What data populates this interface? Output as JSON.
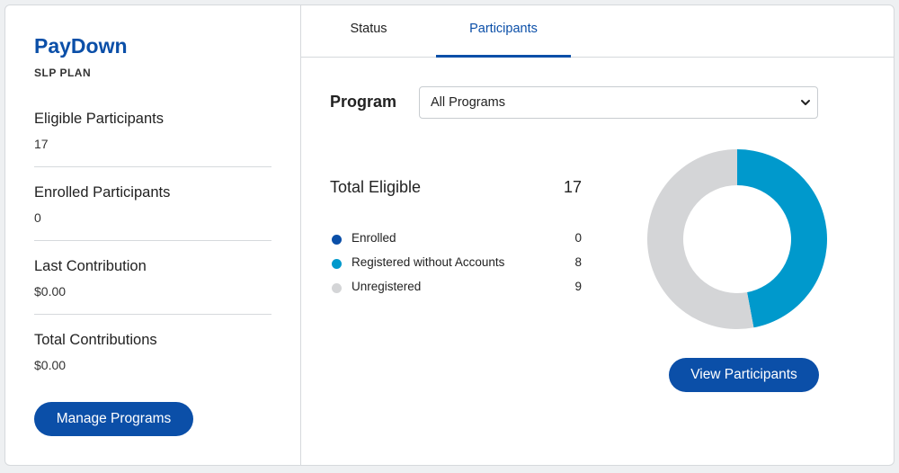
{
  "sidebar": {
    "title": "PayDown",
    "subtitle": "SLP PLAN",
    "stats": [
      {
        "label": "Eligible Participants",
        "value": "17"
      },
      {
        "label": "Enrolled Participants",
        "value": "0"
      },
      {
        "label": "Last Contribution",
        "value": "$0.00"
      },
      {
        "label": "Total Contributions",
        "value": "$0.00"
      }
    ],
    "manage_button": "Manage Programs"
  },
  "tabs": [
    {
      "label": "Status",
      "active": false
    },
    {
      "label": "Participants",
      "active": true
    }
  ],
  "filter": {
    "label": "Program",
    "selected": "All Programs"
  },
  "summary": {
    "total_label": "Total Eligible",
    "total_value": "17"
  },
  "chart_data": {
    "type": "pie",
    "donut": true,
    "categories": [
      "Enrolled",
      "Registered without Accounts",
      "Unregistered"
    ],
    "values": [
      0,
      8,
      9
    ],
    "colors": [
      "#0b4fa8",
      "#0099cc",
      "#d4d5d7"
    ],
    "legend": "left"
  },
  "view_button": "View Participants"
}
